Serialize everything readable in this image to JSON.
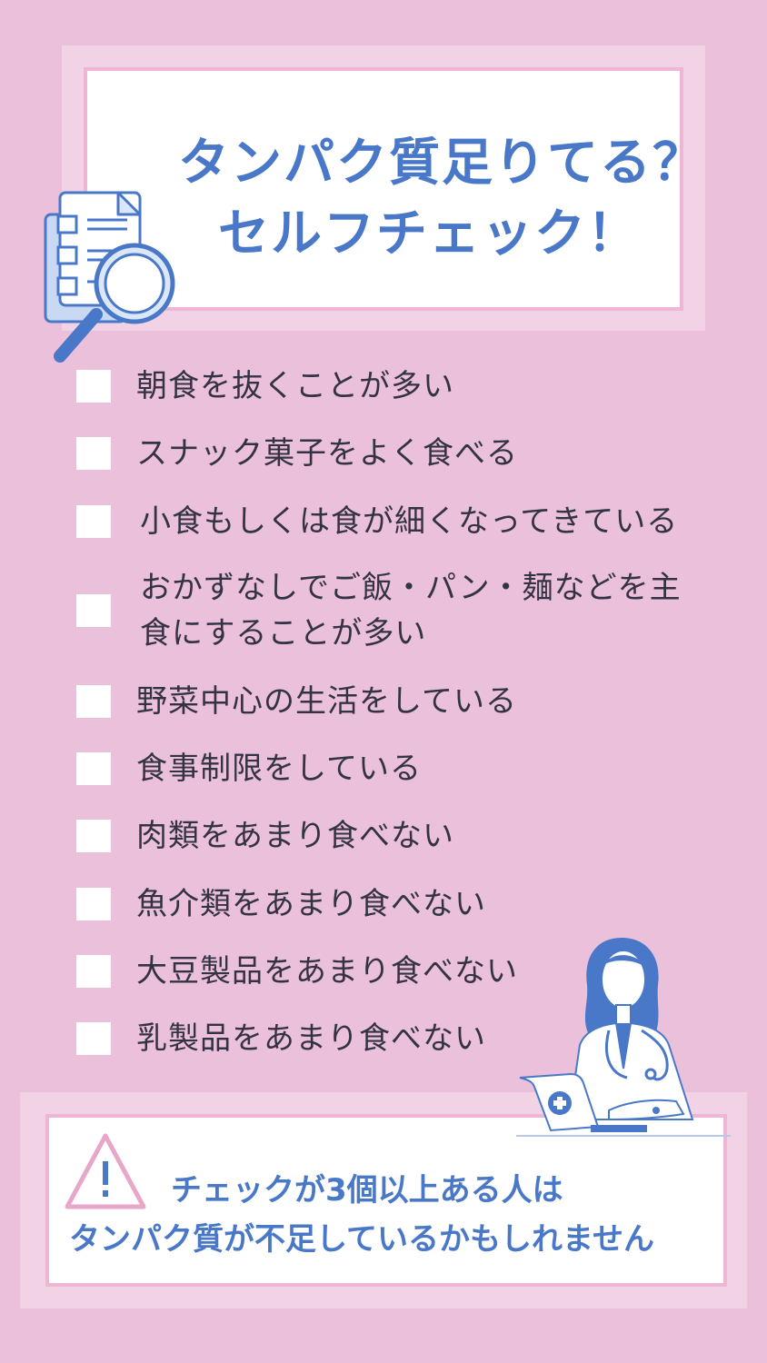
{
  "title": {
    "line1": "タンパク質足りてる？",
    "line2": "セルフチェック！"
  },
  "checklist": [
    {
      "text": "朝食を抜くことが多い"
    },
    {
      "text": "スナック菓子をよく食べる"
    },
    {
      "text": "小食もしくは食が細くなってきている"
    },
    {
      "text": "おかずなしでご飯・パン・麺などを主食にすることが多い"
    },
    {
      "text": "野菜中心の生活をしている"
    },
    {
      "text": "食事制限をしている"
    },
    {
      "text": "肉類をあまり食べない"
    },
    {
      "text": "魚介類をあまり食べない"
    },
    {
      "text": "大豆製品をあまり食べない"
    },
    {
      "text": "乳製品をあまり食べない"
    }
  ],
  "warning": {
    "line1": "チェックが3個以上ある人は",
    "line2": "タンパク質が不足しているかもしれません"
  },
  "icons": {
    "document": "document-magnifier-icon",
    "doctor": "doctor-laptop-icon",
    "warning": "warning-triangle-icon"
  },
  "colors": {
    "background": "#ebc0da",
    "accent_blue": "#4a78c9",
    "pink_border": "#eeb6d2"
  }
}
